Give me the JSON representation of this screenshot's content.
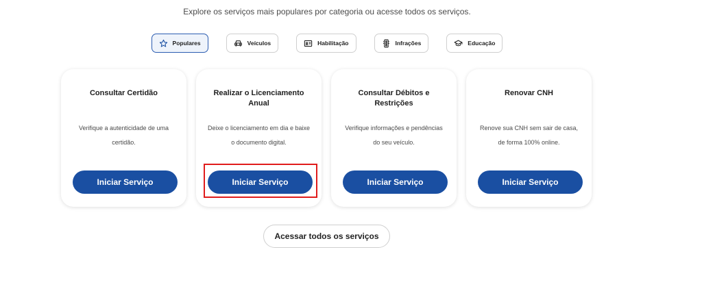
{
  "subtitle": "Explore os serviços mais populares por categoria ou acesse todos os serviços.",
  "tabs": [
    {
      "label": "Populares",
      "icon": "star-icon",
      "active": true
    },
    {
      "label": "Veículos",
      "icon": "car-icon",
      "active": false
    },
    {
      "label": "Habilitação",
      "icon": "id-card-icon",
      "active": false
    },
    {
      "label": "Infrações",
      "icon": "traffic-light-icon",
      "active": false
    },
    {
      "label": "Educação",
      "icon": "graduation-cap-icon",
      "active": false
    }
  ],
  "cards": [
    {
      "title": "Consultar Certidão",
      "description": "Verifique a autenticidade de uma certidão.",
      "button": "Iniciar Serviço"
    },
    {
      "title": "Realizar o Licenciamento Anual",
      "description": "Deixe o licenciamento em dia e baixe o documento digital.",
      "button": "Iniciar Serviço"
    },
    {
      "title": "Consultar Débitos e Restrições",
      "description": "Verifique informações e pendências do seu veículo.",
      "button": "Iniciar Serviço"
    },
    {
      "title": "Renovar CNH",
      "description": "Renove sua CNH sem sair de casa, de forma 100% online.",
      "button": "Iniciar Serviço"
    }
  ],
  "all_services_label": "Acessar todos os serviços",
  "colors": {
    "primary_button": "#1a4fa2",
    "active_tab_border": "#2a5bb0",
    "highlight": "#e01b1b"
  }
}
